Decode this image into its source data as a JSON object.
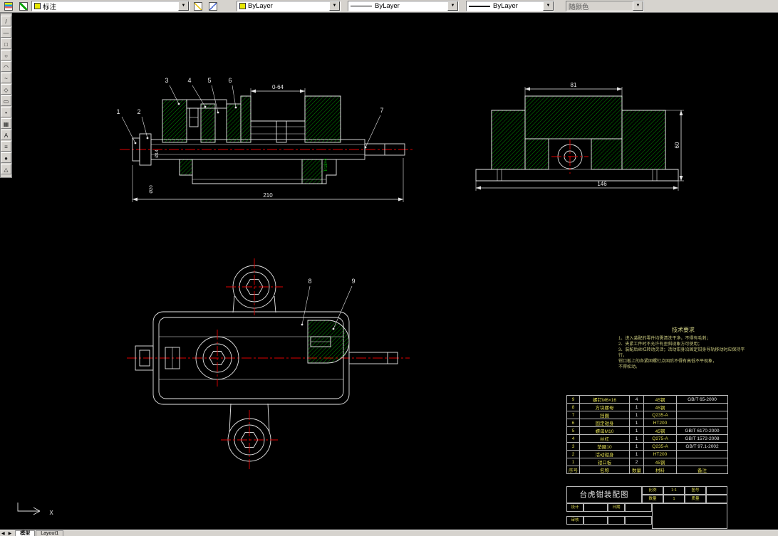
{
  "toolbar": {
    "layer_combo": {
      "value": "标注"
    },
    "color_combo": {
      "value": "ByLayer",
      "chip_color": "#e8e800"
    },
    "linetype_combo": {
      "value": "ByLayer"
    },
    "lineweight_combo": {
      "value": "ByLayer"
    },
    "plot_style_combo": {
      "value": "随颜色"
    }
  },
  "icons": {
    "dropdown_arrow": "▼",
    "tab_prev": "◀",
    "tab_next": "▶",
    "draw_toolbar": [
      "/",
      "—",
      "□",
      "○",
      "◠",
      "~",
      "◇",
      "▭",
      "•",
      "▦",
      "A",
      "≡",
      "●",
      "△"
    ]
  },
  "drawing": {
    "colors": {
      "line": "#e6e6e6",
      "hatch": "#00b400",
      "centerline": "#e00000",
      "thread_text": "#00c000"
    },
    "callouts": [
      "1",
      "2",
      "3",
      "4",
      "5",
      "6",
      "7",
      "8",
      "9"
    ],
    "dims": {
      "jaw_opening": "0-64",
      "front_overall": "210",
      "side_top_width": "81",
      "side_overall_width": "146",
      "side_height": "60",
      "thread_spec": "Tr18×4",
      "left_dia_1": "Ø14",
      "left_dia_2": "Ø20"
    },
    "tech_requirements": {
      "title": "技术要求",
      "lines": [
        "1、进入装配的零件均需清洗干净，不得有毛刺；",
        "2、夹紧工件时不允许有歪斜现象方可使用；",
        "3、装配后丝杠转动灵活；活动钳身沿固定钳身导轨移动时应保持平行，",
        "钳口板上的各紧固螺钉点固后不得有高低不平现象，",
        "不得松动。"
      ]
    }
  },
  "parts_table": {
    "header": {
      "no": "序号",
      "name": "名称",
      "qty": "数量",
      "material": "材料",
      "note": "备注"
    },
    "rows": [
      {
        "no": "9",
        "name": "螺钉M6×16",
        "qty": "4",
        "material": "45钢",
        "note": "GB/T 65-2000"
      },
      {
        "no": "8",
        "name": "方块螺母",
        "qty": "1",
        "material": "45钢",
        "note": ""
      },
      {
        "no": "7",
        "name": "挡圈",
        "qty": "1",
        "material": "Q235-A",
        "note": ""
      },
      {
        "no": "6",
        "name": "固定钳身",
        "qty": "1",
        "material": "HT200",
        "note": ""
      },
      {
        "no": "5",
        "name": "螺母M10",
        "qty": "1",
        "material": "45钢",
        "note": "GB/T 6170-2000"
      },
      {
        "no": "4",
        "name": "丝杠",
        "qty": "1",
        "material": "Q275-A",
        "note": "GB/T 1572-2008"
      },
      {
        "no": "3",
        "name": "垫圈10",
        "qty": "1",
        "material": "Q235-A",
        "note": "GB/T 97.1-2002"
      },
      {
        "no": "2",
        "name": "活动钳身",
        "qty": "1",
        "material": "HT200",
        "note": ""
      },
      {
        "no": "1",
        "name": "钳口板",
        "qty": "2",
        "material": "45钢",
        "note": ""
      }
    ]
  },
  "title_block": {
    "title": "台虎钳装配图",
    "scale_label": "比例",
    "scale_value": "1:1",
    "drawing_no_label": "图号",
    "qty_label": "数量",
    "qty_value": "1",
    "weight_label": "质量",
    "design_label": "设计",
    "review_label": "审核",
    "date_label": "日期"
  },
  "tab_bar": {
    "model_tab": "模型",
    "layout_tab": "Layout1"
  },
  "ucs_icon": {
    "x_label": "X"
  }
}
